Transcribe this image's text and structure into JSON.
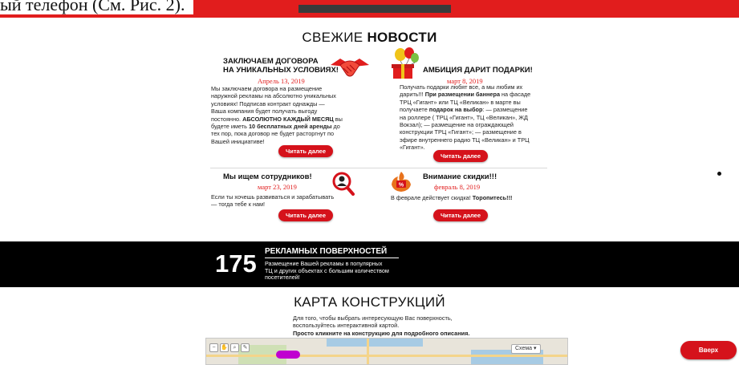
{
  "top_fragment": {
    "text": "ый телефон (См. Рис. 2)."
  },
  "news": {
    "title_normal": "СВЕЖИЕ",
    "title_bold": "НОВОСТИ",
    "read_more": "Читать далее",
    "cards": [
      {
        "title_line1": "ЗАКЛЮЧАЕМ ДОГОВОРА",
        "title_line2": "НА УНИКАЛЬНЫХ УСЛОВИЯХ!",
        "date": "Апрель 13, 2019",
        "text_lines": [
          "Мы заключаем договора на размещение",
          "наружной рекламы на абсолютно уникальных",
          "условиях! Подписав контракт однажды —",
          "Ваша компания будет получать выгоду"
        ],
        "line5_pre": "постоянно. ",
        "line5_bold": "АБСОЛЮТНО КАЖДЫЙ МЕСЯЦ",
        "line5_post": " вы",
        "line6_pre": "будете иметь ",
        "line6_bold": "10 бесплатных дней аренды",
        "line6_post": " до",
        "line7": "тех пор, пока договор не будет расторгнут по",
        "line8": "Вашей инициативе!",
        "icon": "handshake-icon"
      },
      {
        "title": "АМБИЦИЯ ДАРИТ ПОДАРКИ!",
        "date": "март 8, 2019",
        "line1": "Получать подарки любят все, а мы любим их",
        "line2_pre": "дарить!!! ",
        "line2_bold": "При размещении баннера",
        "line2_post": " на фасаде",
        "line3": "ТРЦ «Гигант» или ТЦ «Великан» в марте вы",
        "line4_pre": "получаете ",
        "line4_bold": "подарок на выбор",
        "line4_post": ": — размещение",
        "line5": "на роллере ( ТРЦ «Гигант», ТЦ «Великан», ЖД",
        "line6": "Вокзал); — размещение на ограждающей",
        "line7": "конструкции ТРЦ «Гигант»; — размещение в",
        "line8": "эфире внутреннего радио ТЦ «Великан» и ТРЦ",
        "line9": "«Гигант».",
        "icon": "gift-balloons-icon"
      },
      {
        "title": "Мы ищем сотрудников!",
        "date": "март 23, 2019",
        "line1": "Если ты хочешь развиваться и зарабатывать",
        "line2": "— тогда тебе к нам!",
        "icon": "magnifier-person-icon"
      },
      {
        "title": "Внимание скидки!!!",
        "date": "февраль 8, 2019",
        "line1_pre": "В феврале действует скидка! ",
        "line1_bold": "Торопитесь!!!",
        "icon": "discount-fire-icon"
      }
    ]
  },
  "counter": {
    "number": "175",
    "title": "РЕКЛАМНЫХ ПОВЕРХНОСТЕЙ",
    "desc_line1": "Размещение Вашей рекламы в популярных",
    "desc_line2": "ТЦ и других объектах с большим количеством",
    "desc_line3": "посетителей!"
  },
  "map": {
    "title": "КАРТА КОНСТРУКЦИЙ",
    "desc_line1": "Для того, чтобы выбрать интересующую Вас поверхность,",
    "desc_line2": "воспользуйтесь интерактивной картой.",
    "desc_bold": "Просто кликните на конструкцию для подробного описания.",
    "scheme_label": "Схема ▾"
  },
  "up_button": "Вверх",
  "colors": {
    "accent": "#d5121b",
    "date": "#e11d1d",
    "band": "#000000"
  }
}
